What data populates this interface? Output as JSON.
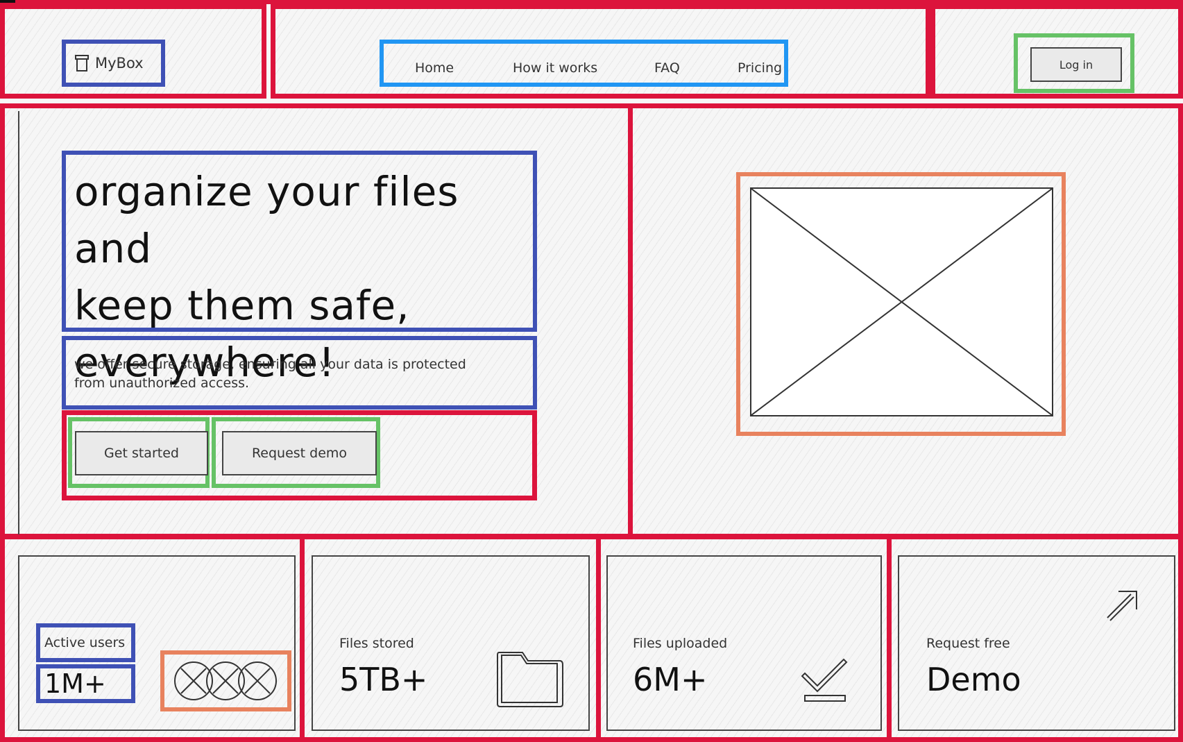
{
  "brand": {
    "name": "MyBox",
    "icon": "box-icon"
  },
  "nav": {
    "items": [
      "Home",
      "How it works",
      "FAQ",
      "Pricing"
    ]
  },
  "auth": {
    "login_label": "Log in"
  },
  "hero": {
    "headline_lines": [
      "organize your files and",
      "keep them safe,",
      "everywhere!"
    ],
    "subtitle_lines": [
      "we offer secure storage, ensuring all your data is protected",
      "from unauthorized access."
    ],
    "primary_cta": "Get started",
    "secondary_cta": "Request demo",
    "image": "image-placeholder"
  },
  "stats": [
    {
      "label": "Active users",
      "value": "1M+",
      "icon": "avatar-group-icon"
    },
    {
      "label": "Files stored",
      "value": "5TB+",
      "icon": "folder-icon"
    },
    {
      "label": "Files uploaded",
      "value": "6M+",
      "icon": "checkmark-icon"
    },
    {
      "label": "Request free",
      "value": "Demo",
      "icon": "arrow-up-right-icon"
    }
  ],
  "colors": {
    "section_outline": "#dc143c",
    "group_outline": "#3f51b5",
    "nav_outline": "#2196f3",
    "button_outline": "#66c266",
    "image_outline": "#e8825e"
  }
}
